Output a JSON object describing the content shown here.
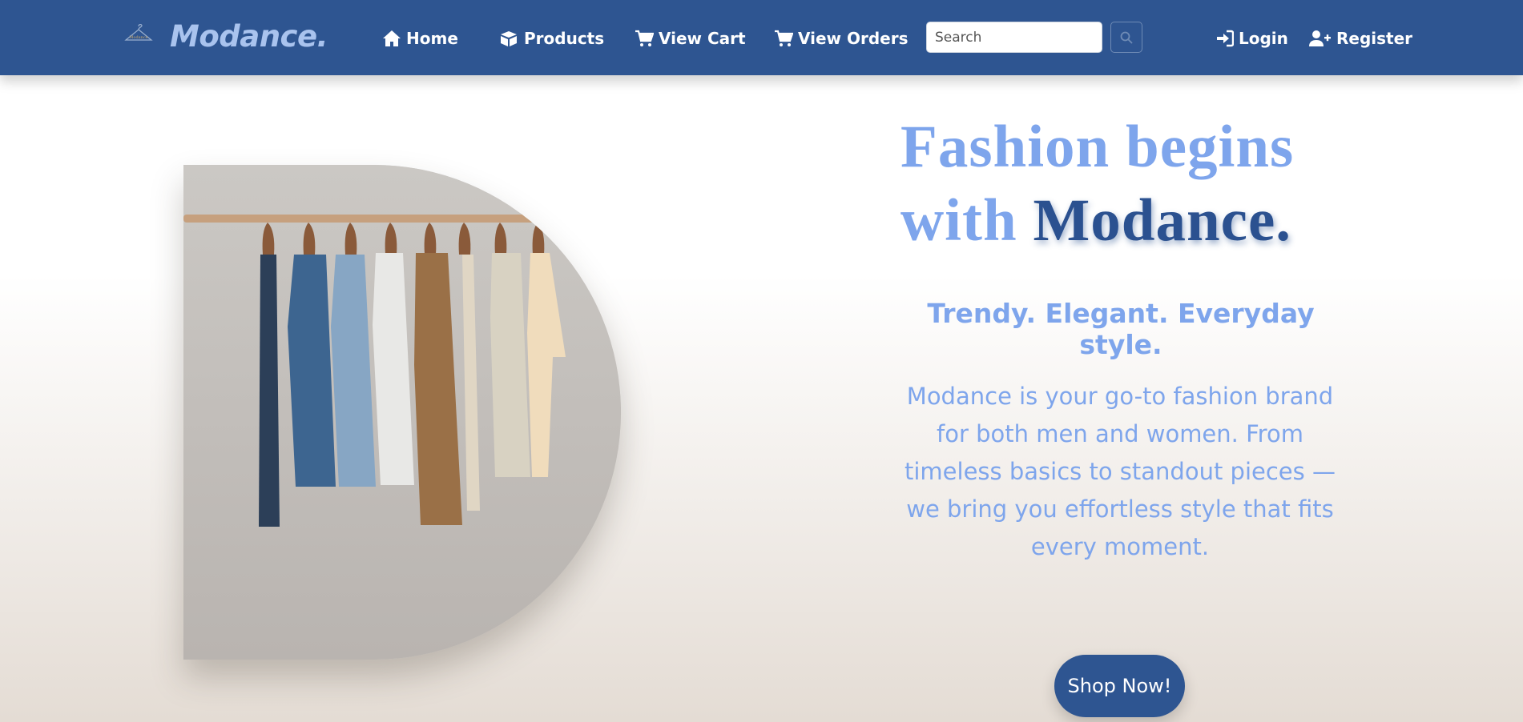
{
  "brand": {
    "name": "Modance.",
    "logo_icon": "hanger-icon",
    "logo_text": "Modance"
  },
  "nav": {
    "home": {
      "label": "Home",
      "icon": "home-icon"
    },
    "products": {
      "label": "Products",
      "icon": "box-icon"
    },
    "view_cart": {
      "label": "View Cart",
      "icon": "cart-icon"
    },
    "view_orders": {
      "label": "View Orders",
      "icon": "cart-icon"
    },
    "login": {
      "label": "Login",
      "icon": "sign-in-icon"
    },
    "register": {
      "label": "Register",
      "icon": "user-plus-icon"
    }
  },
  "search": {
    "placeholder": "Search",
    "value": ""
  },
  "hero": {
    "title_line1": "Fashion begins",
    "title_with": "with ",
    "title_accent": "Modance.",
    "tagline": "Trendy. Elegant. Everyday style.",
    "description": "Modance is your go-to fashion brand for both men and women. From timeless basics to standout pieces — we bring you effortless style that fits every moment.",
    "cta_label": "Shop Now!",
    "image_alt": "clothes-rack-image"
  },
  "colors": {
    "navbar": "#2e5591",
    "accent_light": "#7ea5ec",
    "accent_dark": "#2b5190",
    "brand_text": "#a9c3ee"
  }
}
